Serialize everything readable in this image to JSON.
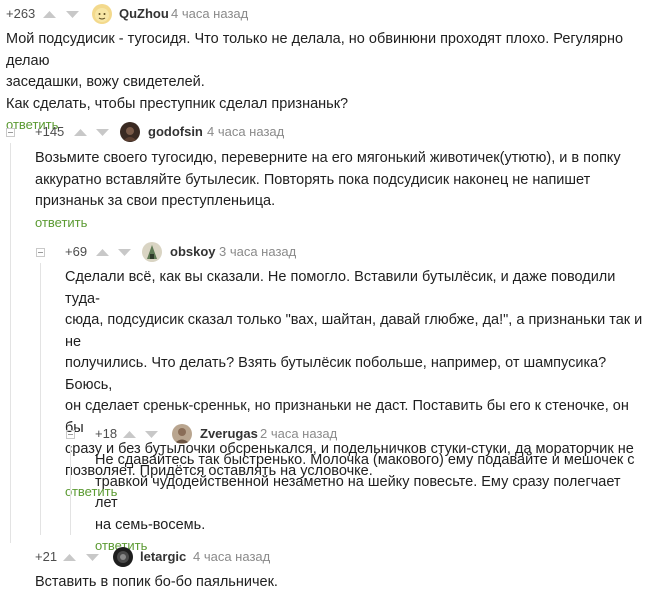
{
  "reply_label": "ответить",
  "comments": [
    {
      "rating": "+263",
      "author": "QuZhou",
      "time": "4 часа назад",
      "lines": [
        "Мой подсудисик - тугосидя. Что только не делала, но обвинюни проходят плохо. Регулярно делаю",
        "заседашки, вожу свидетелей.",
        "Как сделать, чтобы преступник сделал признаньк?"
      ]
    },
    {
      "rating": "+145",
      "author": "godofsin",
      "time": "4 часа назад",
      "lines": [
        "Возьмите своего тугосидю, переверните на его мягонький животичек(утютю), и в попку",
        "аккуратно вставляйте бутылесик. Повторять пока подсудисик наконец не напишет",
        "признаньк за свои преступленьица."
      ]
    },
    {
      "rating": "+69",
      "author": "obskoy",
      "time": "3 часа назад",
      "lines": [
        "Сделали всё, как вы сказали. Не помогло. Вставили бутылёсик, и даже поводили туда-",
        "сюда, подсудисик сказал только \"вах, шайтан, давай глюбже, да!\", а признаньки так и не",
        "получились. Что делать? Взять бутылёсик побольше, например, от шампусика? Боюсь,",
        "он сделает среньк-сренньк, но признаньки не даст. Поставить бы его к стеночке, он бы",
        "сразу и без бутылочки обсренькался, и подельничков стуки-стуки, да мораторчик не",
        "позволяет. Придётся оставлять на условочке."
      ]
    },
    {
      "rating": "+18",
      "author": "Zverugas",
      "time": "2 часа назад",
      "lines": [
        "Не сдавайтесь так быстренько. Молочка (макового) ему подавайте и мешочек с",
        "травкой чудодейственной незаметно на шейку повесьте. Ему сразу полегчает лет",
        "на семь-восемь."
      ]
    },
    {
      "rating": "+21",
      "author": "letargic",
      "time": "4 часа назад",
      "lines": [
        "Вставить в попик бо-бо паяльничек."
      ]
    }
  ]
}
